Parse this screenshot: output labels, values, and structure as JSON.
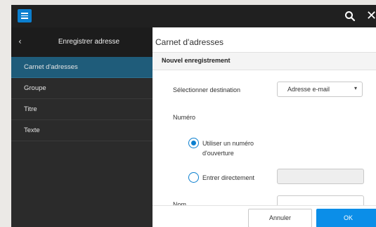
{
  "sidebar": {
    "title": "Enregistrer adresse",
    "items": [
      {
        "label": "Carnet d'adresses",
        "active": true
      },
      {
        "label": "Groupe",
        "active": false
      },
      {
        "label": "Titre",
        "active": false
      },
      {
        "label": "Texte",
        "active": false
      }
    ]
  },
  "main": {
    "title": "Carnet d'adresses",
    "section": "Nouvel enregistrement",
    "destination_label": "Sélectionner destination",
    "destination_value": "Adresse e-mail",
    "numero_label": "Numéro",
    "option_opening_line1": "Utiliser un numéro",
    "option_opening_line2": "d'ouverture",
    "option_direct": "Entrer directement",
    "nom_label": "Nom"
  },
  "footer": {
    "cancel_label": "Annuler",
    "ok_label": "OK"
  },
  "icons": {
    "menu": "hamburger-icon",
    "search": "search-icon",
    "close": "close-icon",
    "back": "chevron-left-icon",
    "dropdown": "chevron-down-icon"
  },
  "colors": {
    "accent": "#0b7fcf",
    "ok_button": "#0b8ee8",
    "active_item": "#1f5c7a"
  }
}
